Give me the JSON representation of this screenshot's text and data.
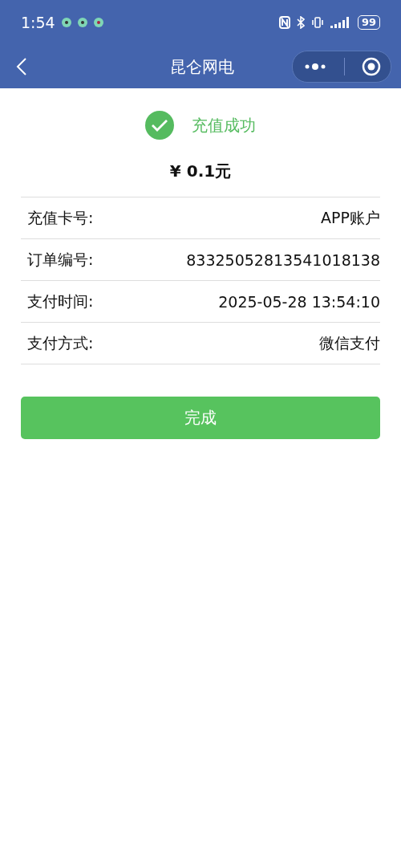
{
  "status_bar": {
    "time": "1:54",
    "battery": "99"
  },
  "nav_bar": {
    "title": "昆仑网电"
  },
  "result": {
    "status": "充值成功",
    "amount": "¥ 0.1元"
  },
  "details": [
    {
      "label": "充值卡号:",
      "value": "APP账户"
    },
    {
      "label": "订单编号:",
      "value": "83325052813541018138"
    },
    {
      "label": "支付时间:",
      "value": "2025-05-28 13:54:10"
    },
    {
      "label": "支付方式:",
      "value": "微信支付"
    }
  ],
  "done_button": "完成"
}
